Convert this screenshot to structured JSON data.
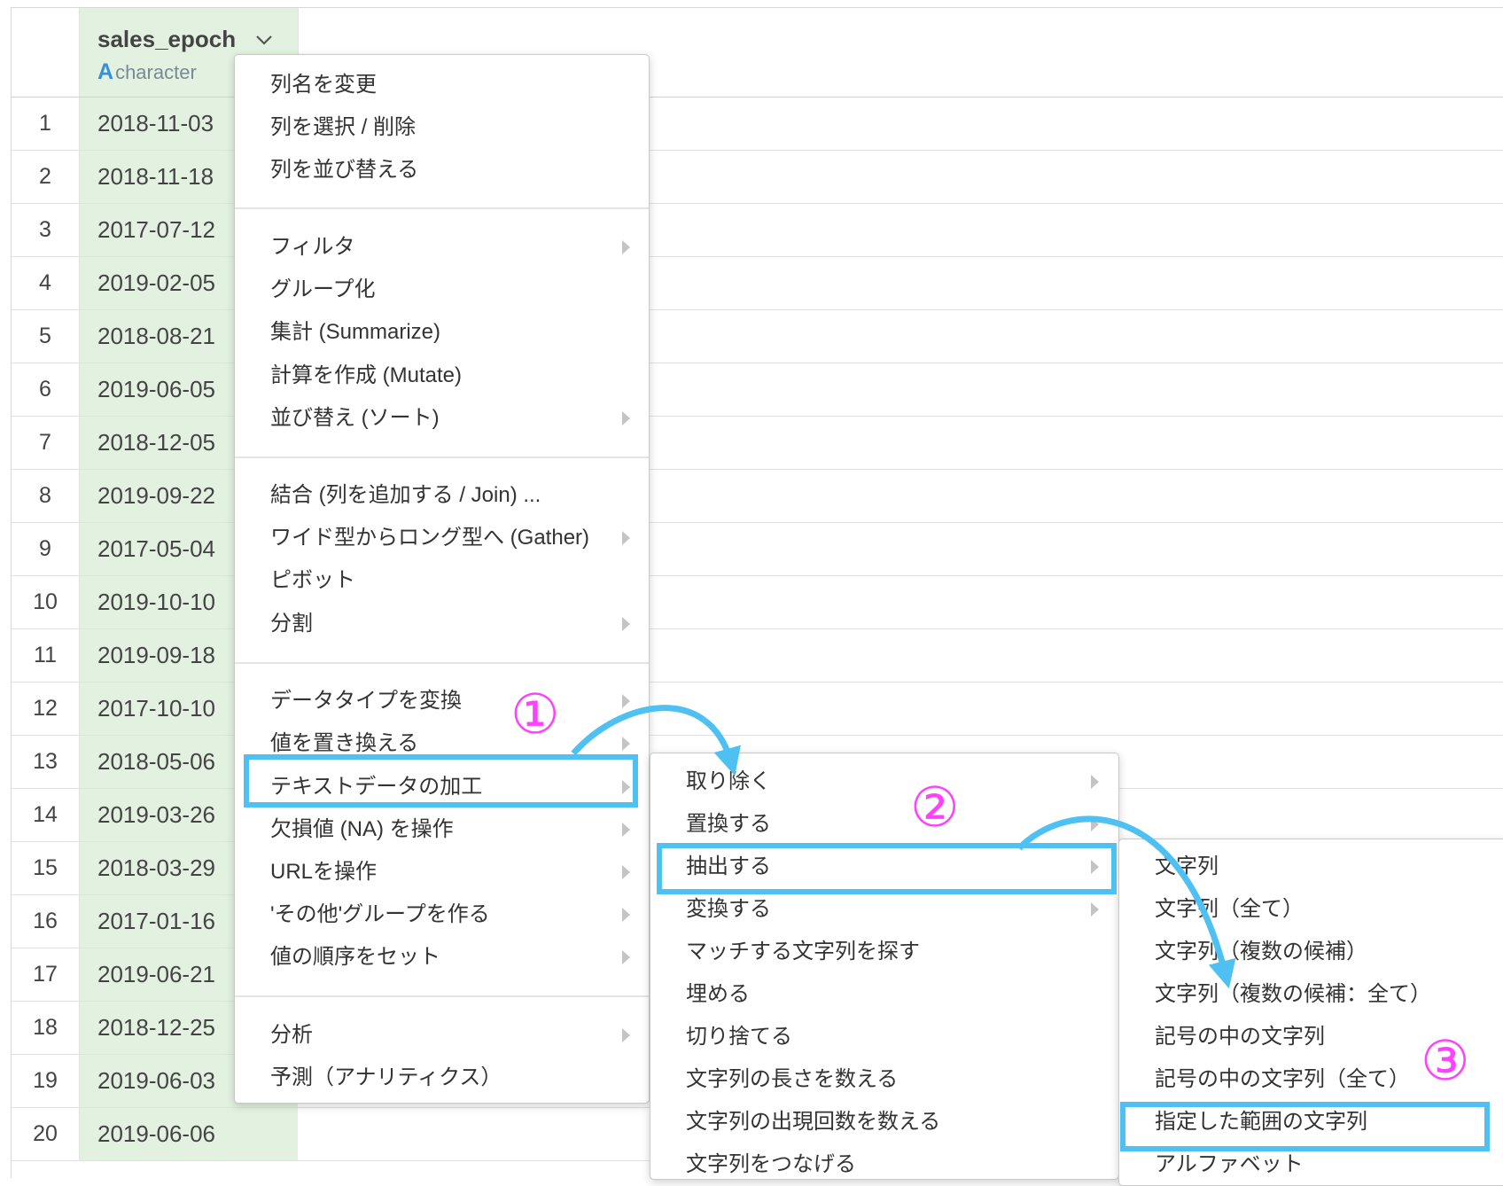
{
  "column": {
    "name": "sales_epoch",
    "type_icon": "A",
    "type": "character"
  },
  "rows": [
    {
      "n": "1",
      "v": "2018-11-03"
    },
    {
      "n": "2",
      "v": "2018-11-18"
    },
    {
      "n": "3",
      "v": "2017-07-12"
    },
    {
      "n": "4",
      "v": "2019-02-05"
    },
    {
      "n": "5",
      "v": "2018-08-21"
    },
    {
      "n": "6",
      "v": "2019-06-05"
    },
    {
      "n": "7",
      "v": "2018-12-05"
    },
    {
      "n": "8",
      "v": "2019-09-22"
    },
    {
      "n": "9",
      "v": "2017-05-04"
    },
    {
      "n": "10",
      "v": "2019-10-10"
    },
    {
      "n": "11",
      "v": "2019-09-18"
    },
    {
      "n": "12",
      "v": "2017-10-10"
    },
    {
      "n": "13",
      "v": "2018-05-06"
    },
    {
      "n": "14",
      "v": "2019-03-26"
    },
    {
      "n": "15",
      "v": "2018-03-29"
    },
    {
      "n": "16",
      "v": "2017-01-16"
    },
    {
      "n": "17",
      "v": "2019-06-21"
    },
    {
      "n": "18",
      "v": "2018-12-25"
    },
    {
      "n": "19",
      "v": "2019-06-03"
    },
    {
      "n": "20",
      "v": "2019-06-06"
    }
  ],
  "menu1": [
    {
      "label": "列名を変更",
      "submenu": false
    },
    {
      "label": "列を選択 / 削除",
      "submenu": false
    },
    {
      "label": "列を並び替える",
      "submenu": false
    },
    {
      "label": "フィルタ",
      "submenu": true
    },
    {
      "label": "グループ化",
      "submenu": false
    },
    {
      "label": "集計 (Summarize)",
      "submenu": false
    },
    {
      "label": "計算を作成 (Mutate)",
      "submenu": false
    },
    {
      "label": "並び替え (ソート)",
      "submenu": true
    },
    {
      "label": "結合 (列を追加する / Join) ...",
      "submenu": false
    },
    {
      "label": "ワイド型からロング型へ (Gather)",
      "submenu": true
    },
    {
      "label": "ピボット",
      "submenu": false
    },
    {
      "label": "分割",
      "submenu": true
    },
    {
      "label": "データタイプを変換",
      "submenu": true
    },
    {
      "label": "値を置き換える",
      "submenu": true
    },
    {
      "label": "テキストデータの加工",
      "submenu": true,
      "highlighted": true
    },
    {
      "label": "欠損値 (NA) を操作",
      "submenu": true
    },
    {
      "label": "URLを操作",
      "submenu": true
    },
    {
      "label": "'その他'グループを作る",
      "submenu": true
    },
    {
      "label": "値の順序をセット",
      "submenu": true
    },
    {
      "label": "分析",
      "submenu": true
    },
    {
      "label": "予測（アナリティクス）",
      "submenu": false
    }
  ],
  "menu2": [
    {
      "label": "取り除く",
      "submenu": true
    },
    {
      "label": "置換する",
      "submenu": true
    },
    {
      "label": "抽出する",
      "submenu": true,
      "highlighted": true
    },
    {
      "label": "変換する",
      "submenu": true
    },
    {
      "label": "マッチする文字列を探す",
      "submenu": false
    },
    {
      "label": "埋める",
      "submenu": false
    },
    {
      "label": "切り捨てる",
      "submenu": false
    },
    {
      "label": "文字列の長さを数える",
      "submenu": false
    },
    {
      "label": "文字列の出現回数を数える",
      "submenu": false
    },
    {
      "label": "文字列をつなげる",
      "submenu": false
    }
  ],
  "menu3": [
    {
      "label": "文字列"
    },
    {
      "label": "文字列（全て）"
    },
    {
      "label": "文字列（複数の候補）"
    },
    {
      "label": "文字列（複数の候補：全て）"
    },
    {
      "label": "記号の中の文字列"
    },
    {
      "label": "記号の中の文字列（全て）"
    },
    {
      "label": "指定した範囲の文字列",
      "highlighted": true
    },
    {
      "label": "アルファベット"
    }
  ],
  "steps": [
    "①",
    "②",
    "③"
  ],
  "colors": {
    "highlight": "#4ec1f2",
    "step": "#ff40ff",
    "column_bg": "#e3f2e0"
  }
}
